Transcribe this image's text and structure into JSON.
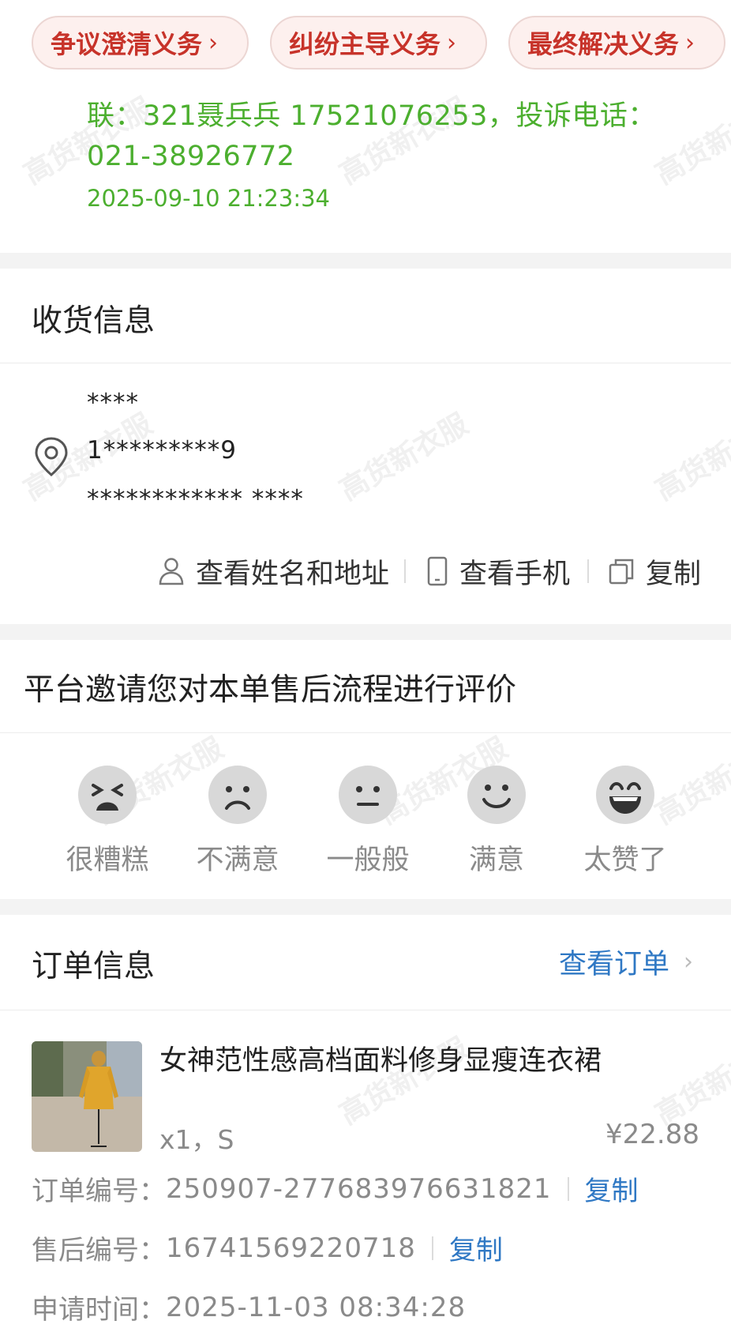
{
  "watermark": "高货新衣服",
  "obligations": [
    {
      "label": "争议澄清义务"
    },
    {
      "label": "纠纷主导义务"
    },
    {
      "label": "最终解决义务"
    }
  ],
  "log": {
    "text_line1": "联：321聂兵兵 17521076253，投诉电话：",
    "text_line2": "021-38926772",
    "time": "2025-09-10 21:23:34"
  },
  "shipping": {
    "title": "收货信息",
    "name": "****",
    "phone": "1*********9",
    "address": "************ ****",
    "actions": {
      "view_name_address": "查看姓名和地址",
      "view_phone": "查看手机",
      "copy": "复制"
    }
  },
  "rating": {
    "title": "平台邀请您对本单售后流程进行评价",
    "options": [
      {
        "label": "很糟糕",
        "icon": "very-bad-face-icon"
      },
      {
        "label": "不满意",
        "icon": "sad-face-icon"
      },
      {
        "label": "一般般",
        "icon": "neutral-face-icon"
      },
      {
        "label": "满意",
        "icon": "smile-face-icon"
      },
      {
        "label": "太赞了",
        "icon": "laugh-face-icon"
      }
    ]
  },
  "order": {
    "title": "订单信息",
    "view_order": "查看订单",
    "product_name": "女神范性感高档面料修身显瘦连衣裙",
    "qty_size": "x1，S",
    "price": "¥22.88",
    "order_no_label": "订单编号：",
    "order_no": "250907-277683976631821",
    "aftersale_no_label": "售后编号：",
    "aftersale_no": "16741569220718",
    "apply_time_label": "申请时间：",
    "apply_time": "2025-11-03 08:34:28",
    "copy": "复制"
  },
  "colors": {
    "accent_red": "#c7332a",
    "green": "#4caf2f",
    "link_blue": "#2f78c4",
    "muted": "#8a8a8a"
  }
}
